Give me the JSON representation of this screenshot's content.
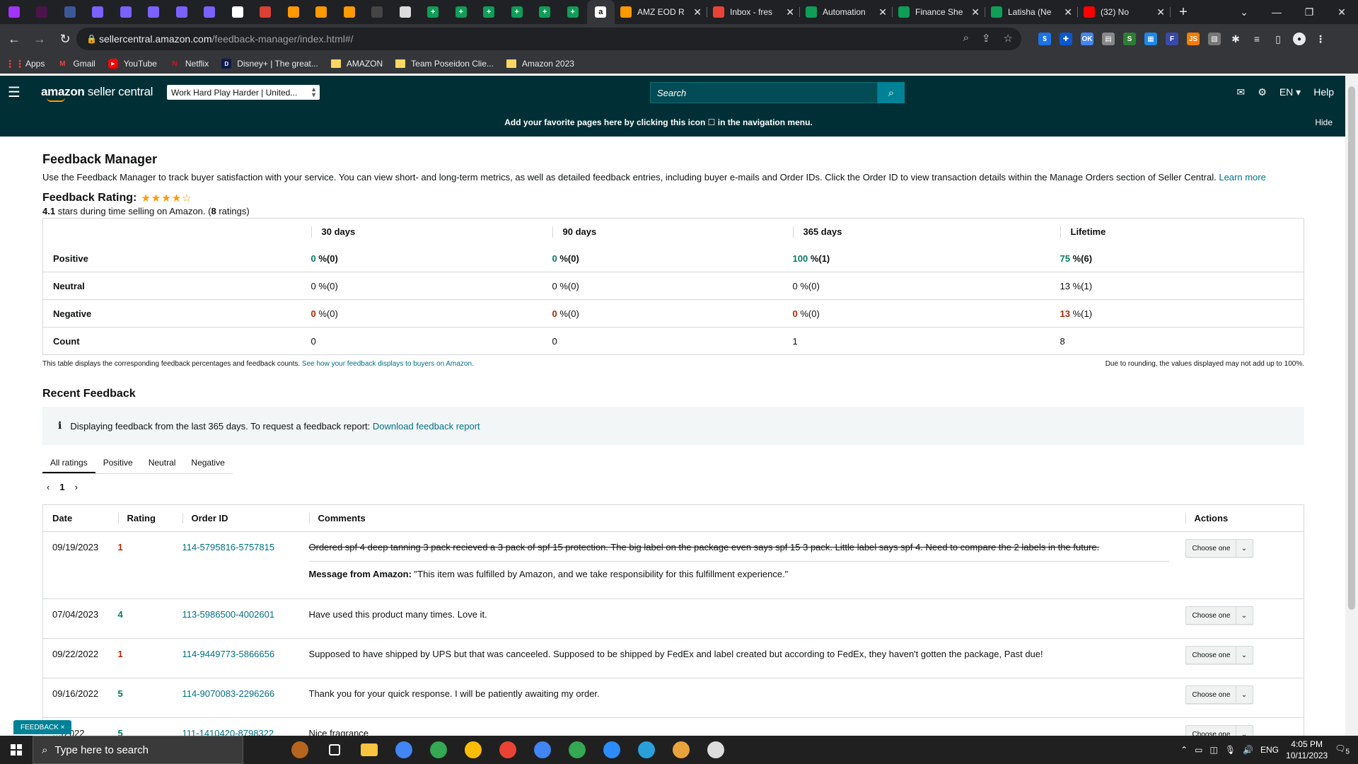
{
  "browser": {
    "pinned_tabs": [
      {
        "icon": "messenger-icon",
        "color": "#a334fa"
      },
      {
        "icon": "slack-icon",
        "color": "#4a154b"
      },
      {
        "icon": "app-icon",
        "color": "#3b5998"
      },
      {
        "icon": "notes-icon",
        "color": "#7b61ff"
      },
      {
        "icon": "notes-icon",
        "color": "#7b61ff"
      },
      {
        "icon": "notes-icon",
        "color": "#7b61ff"
      },
      {
        "icon": "notes-icon",
        "color": "#7b61ff"
      },
      {
        "icon": "notes-icon",
        "color": "#7b61ff"
      },
      {
        "icon": "circle-icon",
        "color": "#ffffff"
      },
      {
        "icon": "todoist-icon",
        "color": "#db4035"
      },
      {
        "icon": "zap-icon",
        "color": "#ff9900"
      },
      {
        "icon": "zap-icon",
        "color": "#ff9900"
      },
      {
        "icon": "zap-icon",
        "color": "#ff9900"
      },
      {
        "icon": "dark-circle-icon",
        "color": "#444444"
      },
      {
        "icon": "globe-icon",
        "color": "#dddddd"
      },
      {
        "icon": "sheets-icon",
        "color": "#0f9d58"
      },
      {
        "icon": "sheets-icon",
        "color": "#0f9d58"
      },
      {
        "icon": "sheets-icon",
        "color": "#0f9d58"
      },
      {
        "icon": "sheets-icon",
        "color": "#0f9d58"
      },
      {
        "icon": "sheets-icon",
        "color": "#0f9d58"
      },
      {
        "icon": "sheets-icon",
        "color": "#0f9d58"
      },
      {
        "icon": "amazon-icon",
        "color": "#ffffff",
        "active": true
      }
    ],
    "tabs": [
      {
        "title": "AMZ EOD R",
        "icon": "zap-icon",
        "color": "#ff9900"
      },
      {
        "title": "Inbox - fres",
        "icon": "gmail-icon",
        "color": "#ea4335"
      },
      {
        "title": "Automation",
        "icon": "sheets-icon",
        "color": "#0f9d58"
      },
      {
        "title": "Finance She",
        "icon": "sheets-icon",
        "color": "#0f9d58"
      },
      {
        "title": "Latisha (Ne",
        "icon": "sheets-icon",
        "color": "#0f9d58"
      },
      {
        "title": "(32) No",
        "icon": "youtube-icon",
        "color": "#ff0000"
      }
    ],
    "url_host": "sellercentral.amazon.com",
    "url_path": "/feedback-manager/index.html#/",
    "bookmarks": [
      {
        "label": "Apps",
        "icon": "apps-grid-icon"
      },
      {
        "label": "Gmail",
        "icon": "gmail-icon"
      },
      {
        "label": "YouTube",
        "icon": "youtube-icon"
      },
      {
        "label": "Netflix",
        "icon": "netflix-icon"
      },
      {
        "label": "Disney+ | The great...",
        "icon": "disney-icon"
      },
      {
        "label": "AMAZON",
        "icon": "folder-icon"
      },
      {
        "label": "Team Poseidon Clie...",
        "icon": "folder-icon"
      },
      {
        "label": "Amazon 2023",
        "icon": "folder-icon"
      }
    ]
  },
  "header": {
    "logo_bold": "amazon",
    "logo_rest": " seller central",
    "store": "Work Hard Play Harder | United...",
    "search_placeholder": "Search",
    "language": "EN",
    "help": "Help"
  },
  "banner": {
    "message": "Add your favorite pages here by clicking this icon ☐ in the navigation menu.",
    "hide": "Hide"
  },
  "page": {
    "title": "Feedback Manager",
    "description": "Use the Feedback Manager to track buyer satisfaction with your service. You can view short- and long-term metrics, as well as detailed feedback entries, including buyer e-mails and Order IDs. Click the Order ID to view transaction details within the Manage Orders section of Seller Central.",
    "learn_more": "Learn more",
    "rating_label": "Feedback Rating:",
    "stars": "★★★★☆",
    "rating_value": "4.1",
    "rating_text": " stars during time selling on Amazon. (",
    "rating_count": "8",
    "rating_suffix": " ratings)"
  },
  "metrics": {
    "columns": [
      "30 days",
      "90 days",
      "365 days",
      "Lifetime"
    ],
    "rows": [
      {
        "label": "Positive",
        "cells": [
          {
            "pct": "0",
            "rest": " %(0)",
            "tone": "g"
          },
          {
            "pct": "0",
            "rest": " %(0)",
            "tone": "g"
          },
          {
            "pct": "100",
            "rest": " %(1)",
            "tone": "g"
          },
          {
            "pct": "75",
            "rest": " %(6)",
            "tone": "g"
          }
        ]
      },
      {
        "label": "Neutral",
        "cells": [
          {
            "pct": "0",
            "rest": " %(0)",
            "tone": ""
          },
          {
            "pct": "0",
            "rest": " %(0)",
            "tone": ""
          },
          {
            "pct": "0",
            "rest": " %(0)",
            "tone": ""
          },
          {
            "pct": "13",
            "rest": " %(1)",
            "tone": ""
          }
        ]
      },
      {
        "label": "Negative",
        "cells": [
          {
            "pct": "0",
            "rest": " %(0)",
            "tone": "r"
          },
          {
            "pct": "0",
            "rest": " %(0)",
            "tone": "r"
          },
          {
            "pct": "0",
            "rest": " %(0)",
            "tone": "r"
          },
          {
            "pct": "13",
            "rest": " %(1)",
            "tone": "r"
          }
        ]
      },
      {
        "label": "Count",
        "cells": [
          {
            "pct": "",
            "rest": "0",
            "tone": ""
          },
          {
            "pct": "",
            "rest": "0",
            "tone": ""
          },
          {
            "pct": "",
            "rest": "1",
            "tone": ""
          },
          {
            "pct": "",
            "rest": "8",
            "tone": ""
          }
        ]
      }
    ],
    "note": "This table displays the corresponding feedback percentages and feedback counts.",
    "note_link": "See how your feedback displays to buyers on Amazon.",
    "rounding_note": "Due to rounding, the values displayed may not add up to 100%."
  },
  "recent": {
    "title": "Recent Feedback",
    "info_text": "Displaying feedback from the last 365 days. To request a feedback report:",
    "info_link": "Download feedback report",
    "tabs": [
      "All ratings",
      "Positive",
      "Neutral",
      "Negative"
    ],
    "page": "1",
    "headers": [
      "Date",
      "Rating",
      "Order ID",
      "Comments",
      "Actions"
    ],
    "action_label": "Choose one",
    "rows": [
      {
        "date": "09/19/2023",
        "rating": "1",
        "tone": "r",
        "order": "114-5795816-5757815",
        "comment": "Ordered spf 4 deep tanning 3 pack recieved a 3 pack of spf 15 protection. The big label on the package even says spf 15 3 pack. Little label says spf 4. Need to compare the 2 labels in the future.",
        "struck": true,
        "amazon_label": "Message from Amazon:",
        "amazon_msg": " \"This item was fulfilled by Amazon, and we take responsibility for this fulfillment experience.\""
      },
      {
        "date": "07/04/2023",
        "rating": "4",
        "tone": "g",
        "order": "113-5986500-4002601",
        "comment": "Have used this product many times. Love it.",
        "struck": false
      },
      {
        "date": "09/22/2022",
        "rating": "1",
        "tone": "r",
        "order": "114-9449773-5866656",
        "comment": "Supposed to have shipped by UPS but that was canceeled. Supposed to be shipped by FedEx and label created but according to FedEx, they haven't gotten the package, Past due!",
        "struck": false
      },
      {
        "date": "09/16/2022",
        "rating": "5",
        "tone": "g",
        "order": "114-9070083-2296266",
        "comment": "Thank you for your quick response. I will be patiently awaiting my order.",
        "struck": false
      },
      {
        "date": "…/2022",
        "rating": "5",
        "tone": "g",
        "order": "111-1410420-8798322",
        "comment": "Nice fragrance",
        "struck": false
      }
    ]
  },
  "feedback_pill": "FEEDBACK ×",
  "taskbar": {
    "search_placeholder": "Type here to search",
    "language": "ENG",
    "time": "4:05 PM",
    "date": "10/11/2023",
    "notifications": "5"
  }
}
